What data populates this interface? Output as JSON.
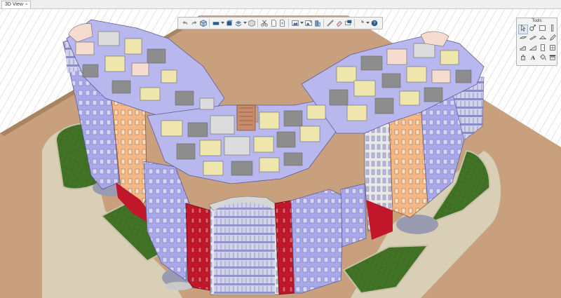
{
  "app": {
    "tab_title": "3D View",
    "tab_close_glyph": "×"
  },
  "toolbar": {
    "buttons": [
      {
        "icon": "undo-icon"
      },
      {
        "icon": "redo-icon"
      },
      {
        "icon": "view-cube-icon"
      },
      {
        "icon": "floor-plane-icon"
      },
      {
        "icon": "section-box-icon"
      },
      {
        "icon": "layers-icon"
      },
      {
        "icon": "object-box-icon"
      },
      {
        "icon": "cut-icon"
      },
      {
        "icon": "page-icon"
      },
      {
        "icon": "document-icon"
      },
      {
        "icon": "picture-icon"
      },
      {
        "icon": "picture-edit-icon"
      },
      {
        "icon": "building-icon"
      },
      {
        "icon": "measure-icon"
      },
      {
        "icon": "eraser-icon"
      },
      {
        "icon": "display-icon"
      },
      {
        "icon": "wrench-icon"
      },
      {
        "icon": "help-icon"
      }
    ]
  },
  "tools_panel": {
    "title": "Tools",
    "items": [
      {
        "icon": "select-pointer-icon",
        "selected": true
      },
      {
        "icon": "orbit-icon",
        "selected": false
      },
      {
        "icon": "wall-icon",
        "selected": false
      },
      {
        "icon": "column-icon",
        "selected": false
      },
      {
        "icon": "slab-icon",
        "selected": false
      },
      {
        "icon": "beam-icon",
        "selected": false
      },
      {
        "icon": "roof-icon",
        "selected": false
      },
      {
        "icon": "pencil-icon",
        "selected": false
      },
      {
        "icon": "stair-icon",
        "selected": false
      },
      {
        "icon": "ramp-icon",
        "selected": false
      },
      {
        "icon": "door-icon",
        "selected": false
      },
      {
        "icon": "window-icon",
        "selected": false
      },
      {
        "icon": "object-icon",
        "selected": false
      },
      {
        "icon": "text-icon",
        "selected": false
      },
      {
        "icon": "paint-icon",
        "selected": false
      },
      {
        "icon": "ceiling-icon",
        "selected": false
      }
    ]
  },
  "colors": {
    "site_ground": "#c8a07e",
    "lawn": "#3f6f24",
    "facade_blue": "#a9a9ea",
    "facade_red": "#c1172a",
    "facade_peach": "#f4b886",
    "wall_cream": "#eee6ad",
    "floor_lavender": "#b8b8ef",
    "roof_light": "#dedede",
    "column_grey": "#8d8d8d",
    "toolbar_blue": "#2a5a8c"
  }
}
